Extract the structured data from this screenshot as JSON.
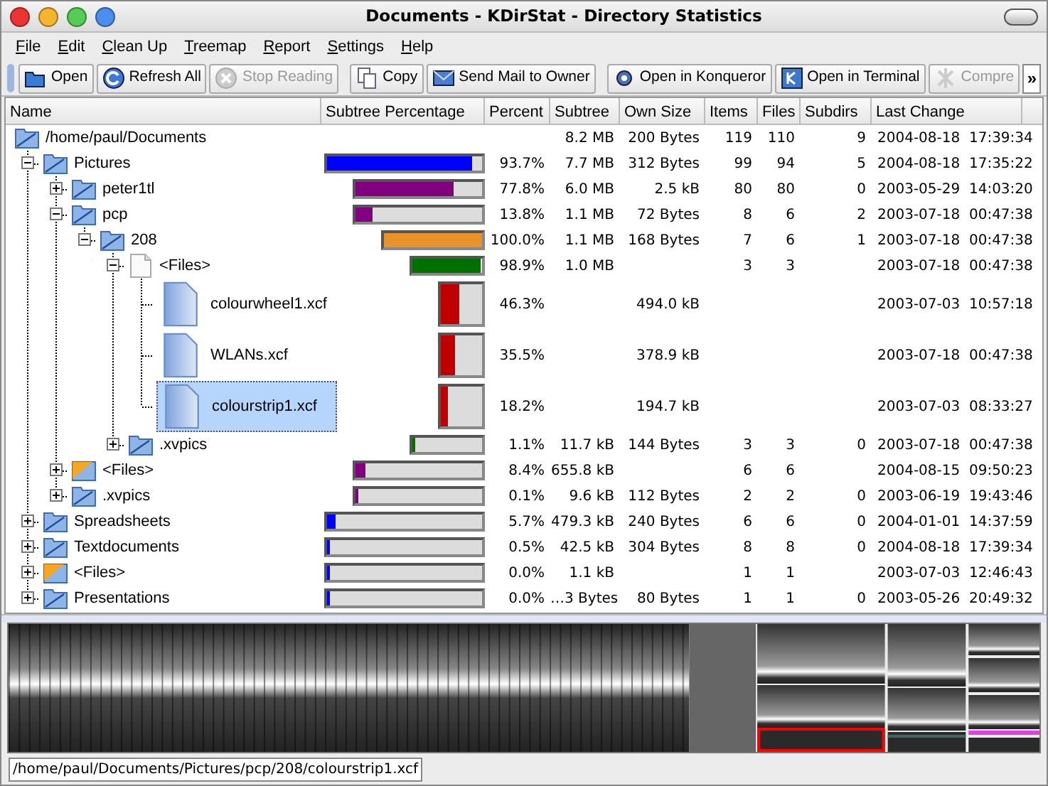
{
  "window": {
    "title": "Documents - KDirStat - Directory Statistics"
  },
  "menu": [
    "File",
    "Edit",
    "Clean Up",
    "Treemap",
    "Report",
    "Settings",
    "Help"
  ],
  "toolbar": [
    {
      "label": "Open",
      "disabled": false
    },
    {
      "label": "Refresh All",
      "disabled": false
    },
    {
      "label": "Stop Reading",
      "disabled": true
    },
    {
      "label": "Copy",
      "disabled": false
    },
    {
      "label": "Send Mail to Owner",
      "disabled": false
    },
    {
      "label": "Open in Konqueror",
      "disabled": false
    },
    {
      "label": "Open in Terminal",
      "disabled": false
    },
    {
      "label": "Compre",
      "disabled": true
    }
  ],
  "toolbar_overflow": "»",
  "columns": [
    "Name",
    "Subtree Percentage",
    "Percent",
    "Subtree",
    "Own Size",
    "Items",
    "Files",
    "Subdirs",
    "Last Change"
  ],
  "tree": {
    "name": "/home/paul/Documents",
    "kind": "folder",
    "selected": false,
    "subtree": "8.2 MB",
    "own_size": "200 Bytes",
    "items": "119",
    "files": "110",
    "subdirs": "9",
    "last_change": "2004-08-18  17:39:34",
    "children": [
      {
        "name": "Pictures",
        "kind": "folder",
        "expanded": true,
        "selected": false,
        "level": 0.937,
        "color": "#0000ff",
        "percent": "93.7%",
        "subtree": "7.7 MB",
        "own_size": "312 Bytes",
        "items": "99",
        "files": "94",
        "subdirs": "5",
        "last_change": "2004-08-18  17:35:22",
        "children": [
          {
            "name": "peter1tl",
            "kind": "folder",
            "expanded": false,
            "selected": false,
            "level": 0.778,
            "color": "#800080",
            "percent": "77.8%",
            "subtree": "6.0 MB",
            "own_size": "2.5 kB",
            "items": "80",
            "files": "80",
            "subdirs": "0",
            "last_change": "2003-05-29  14:03:20"
          },
          {
            "name": "pcp",
            "kind": "folder",
            "expanded": true,
            "selected": false,
            "level": 0.138,
            "color": "#800080",
            "percent": "13.8%",
            "subtree": "1.1 MB",
            "own_size": "72 Bytes",
            "items": "8",
            "files": "6",
            "subdirs": "2",
            "last_change": "2003-07-18  00:47:38",
            "children": [
              {
                "name": "208",
                "kind": "folder",
                "expanded": true,
                "selected": false,
                "level": 1.0,
                "color": "#e8922e",
                "percent": "100.0%",
                "subtree": "1.1 MB",
                "own_size": "168 Bytes",
                "items": "7",
                "files": "6",
                "subdirs": "1",
                "last_change": "2003-07-18  00:47:38",
                "children": [
                  {
                    "name": "<Files>",
                    "kind": "pseudo",
                    "expanded": true,
                    "selected": false,
                    "level": 0.989,
                    "color": "#007000",
                    "percent": "98.9%",
                    "subtree": "1.0 MB",
                    "items": "3",
                    "files": "3",
                    "last_change": "2003-07-18  00:47:38",
                    "children": [
                      {
                        "name": "colourwheel1.xcf",
                        "kind": "file",
                        "selected": false,
                        "level": 0.463,
                        "color": "#c00000",
                        "percent": "46.3%",
                        "own_size": "494.0 kB",
                        "last_change": "2003-07-03  10:57:18"
                      },
                      {
                        "name": "WLANs.xcf",
                        "kind": "file",
                        "selected": false,
                        "level": 0.355,
                        "color": "#c00000",
                        "percent": "35.5%",
                        "own_size": "378.9 kB",
                        "last_change": "2003-07-18  00:47:38"
                      },
                      {
                        "name": "colourstrip1.xcf",
                        "kind": "file",
                        "selected": true,
                        "level": 0.182,
                        "color": "#c00000",
                        "percent": "18.2%",
                        "own_size": "194.7 kB",
                        "last_change": "2003-07-03  08:33:27"
                      }
                    ]
                  },
                  {
                    "name": ".xvpics",
                    "kind": "folder",
                    "expanded": false,
                    "selected": false,
                    "level": 0.011,
                    "color": "#007000",
                    "percent": "1.1%",
                    "subtree": "11.7 kB",
                    "own_size": "144 Bytes",
                    "items": "3",
                    "files": "3",
                    "subdirs": "0",
                    "last_change": "2003-07-18  00:47:38"
                  }
                ]
              }
            ]
          },
          {
            "name": "<Files>",
            "kind": "mixed",
            "expanded": false,
            "selected": false,
            "level": 0.084,
            "color": "#800080",
            "percent": "8.4%",
            "subtree": "655.8 kB",
            "items": "6",
            "files": "6",
            "last_change": "2004-08-15  09:50:23"
          },
          {
            "name": ".xvpics",
            "kind": "folder",
            "expanded": false,
            "selected": false,
            "level": 0.001,
            "color": "#800080",
            "percent": "0.1%",
            "subtree": "9.6 kB",
            "own_size": "112 Bytes",
            "items": "2",
            "files": "2",
            "subdirs": "0",
            "last_change": "2003-06-19  19:43:46"
          }
        ]
      },
      {
        "name": "Spreadsheets",
        "kind": "folder",
        "expanded": false,
        "selected": false,
        "level": 0.057,
        "color": "#0000ff",
        "percent": "5.7%",
        "subtree": "479.3 kB",
        "own_size": "240 Bytes",
        "items": "6",
        "files": "6",
        "subdirs": "0",
        "last_change": "2004-01-01  14:37:59"
      },
      {
        "name": "Textdocuments",
        "kind": "folder",
        "expanded": false,
        "selected": false,
        "level": 0.005,
        "color": "#0000ff",
        "percent": "0.5%",
        "subtree": "42.5 kB",
        "own_size": "304 Bytes",
        "items": "8",
        "files": "8",
        "subdirs": "0",
        "last_change": "2004-08-18  17:39:34"
      },
      {
        "name": "<Files>",
        "kind": "mixed",
        "expanded": false,
        "selected": false,
        "level": 0.0,
        "color": "#0000ff",
        "percent": "0.0%",
        "subtree": "1.1 kB",
        "items": "1",
        "files": "1",
        "last_change": "2003-07-03  12:46:43"
      },
      {
        "name": "Presentations",
        "kind": "folder",
        "expanded": false,
        "selected": false,
        "level": 0.0,
        "color": "#0000ff",
        "percent": "0.0%",
        "subtree": "…3 Bytes",
        "own_size": "80 Bytes",
        "items": "1",
        "files": "1",
        "subdirs": "0",
        "last_change": "2003-05-26  20:49:32"
      }
    ]
  },
  "status_bar": "/home/paul/Documents/Pictures/pcp/208/colourstrip1.xcf"
}
